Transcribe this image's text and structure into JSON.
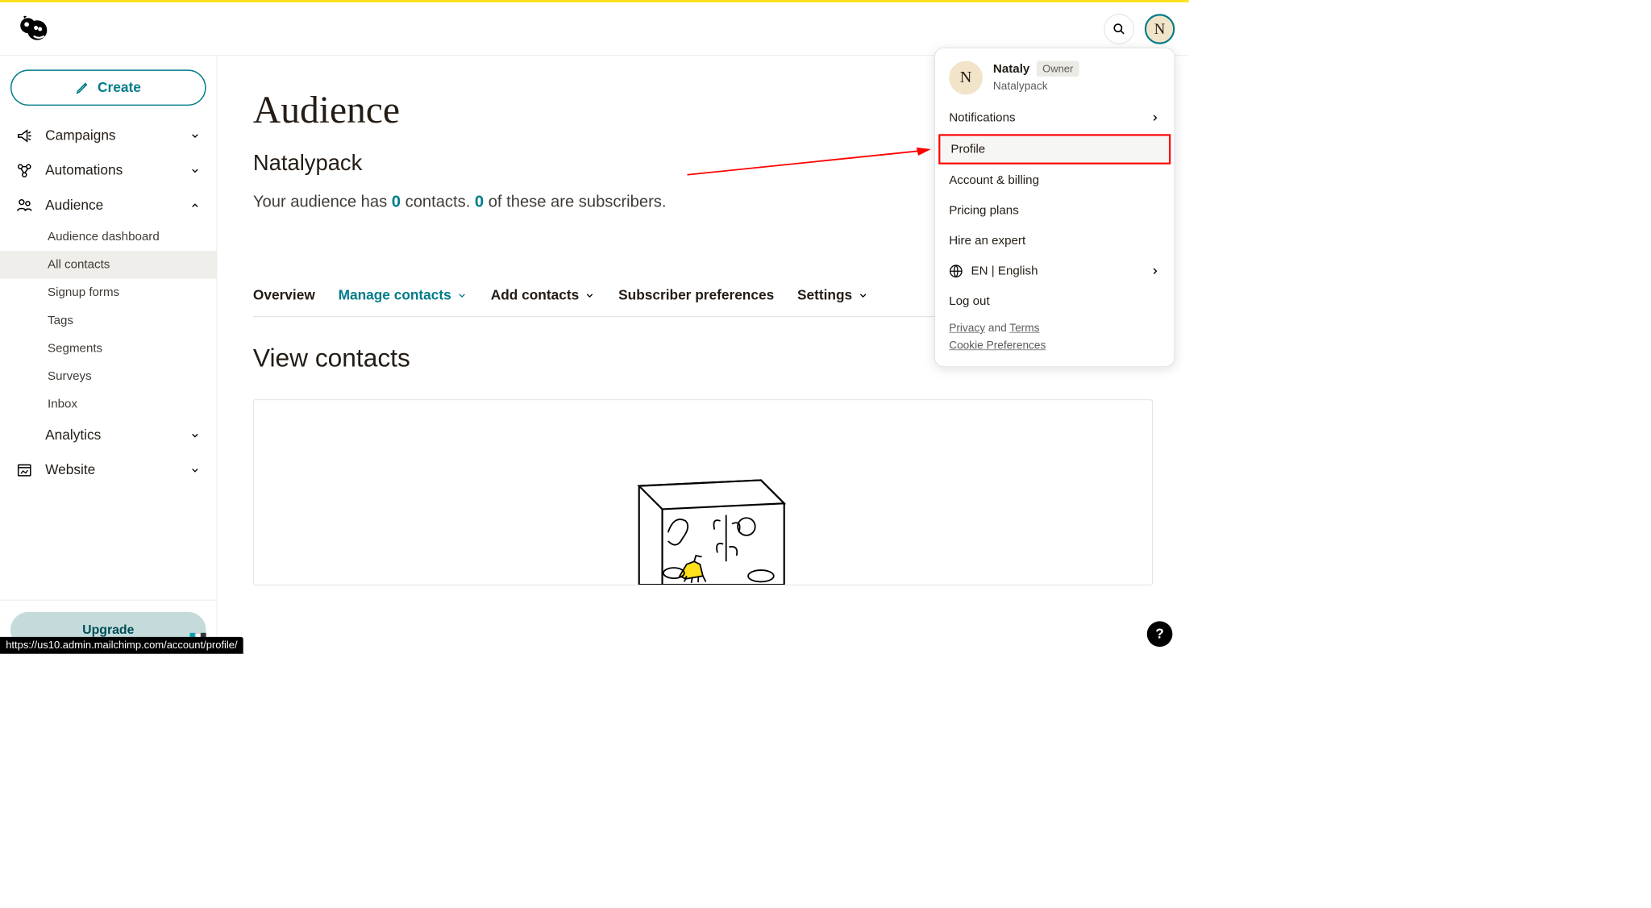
{
  "header": {
    "avatar_letter": "N"
  },
  "sidebar": {
    "create_label": "Create",
    "items": [
      {
        "label": "Campaigns",
        "expanded": false
      },
      {
        "label": "Automations",
        "expanded": false
      },
      {
        "label": "Audience",
        "expanded": true,
        "subitems": [
          {
            "label": "Audience dashboard",
            "active": false
          },
          {
            "label": "All contacts",
            "active": true
          },
          {
            "label": "Signup forms",
            "active": false
          },
          {
            "label": "Tags",
            "active": false
          },
          {
            "label": "Segments",
            "active": false
          },
          {
            "label": "Surveys",
            "active": false
          },
          {
            "label": "Inbox",
            "active": false
          }
        ]
      },
      {
        "label": "Analytics",
        "expanded": false
      },
      {
        "label": "Website",
        "expanded": false
      }
    ],
    "upgrade_label": "Upgrade"
  },
  "main": {
    "title": "Audience",
    "subtitle": "Natalypack",
    "contact_text_pre": "Your audience has ",
    "contact_count": "0",
    "contact_text_mid": " contacts. ",
    "subscriber_count": "0",
    "contact_text_post": " of these are subscribers.",
    "tabs": [
      {
        "label": "Overview"
      },
      {
        "label": "Manage contacts",
        "active": true,
        "caret": true
      },
      {
        "label": "Add contacts",
        "caret": true
      },
      {
        "label": "Subscriber preferences"
      },
      {
        "label": "Settings",
        "caret": true
      }
    ],
    "view_heading": "View contacts"
  },
  "profile_menu": {
    "avatar_letter": "N",
    "name": "Nataly",
    "role_badge": "Owner",
    "company": "Natalypack",
    "items": [
      {
        "label": "Notifications",
        "chevron": true
      },
      {
        "label": "Profile",
        "highlight": true
      },
      {
        "label": "Account & billing"
      },
      {
        "label": "Pricing plans"
      },
      {
        "label": "Hire an expert"
      },
      {
        "label": "EN | English",
        "chevron": true,
        "globe": true
      },
      {
        "label": "Log out"
      }
    ],
    "footer": {
      "privacy": "Privacy",
      "and": " and ",
      "terms": "Terms",
      "cookie": "Cookie Preferences"
    }
  },
  "status_url": "https://us10.admin.mailchimp.com/account/profile/"
}
